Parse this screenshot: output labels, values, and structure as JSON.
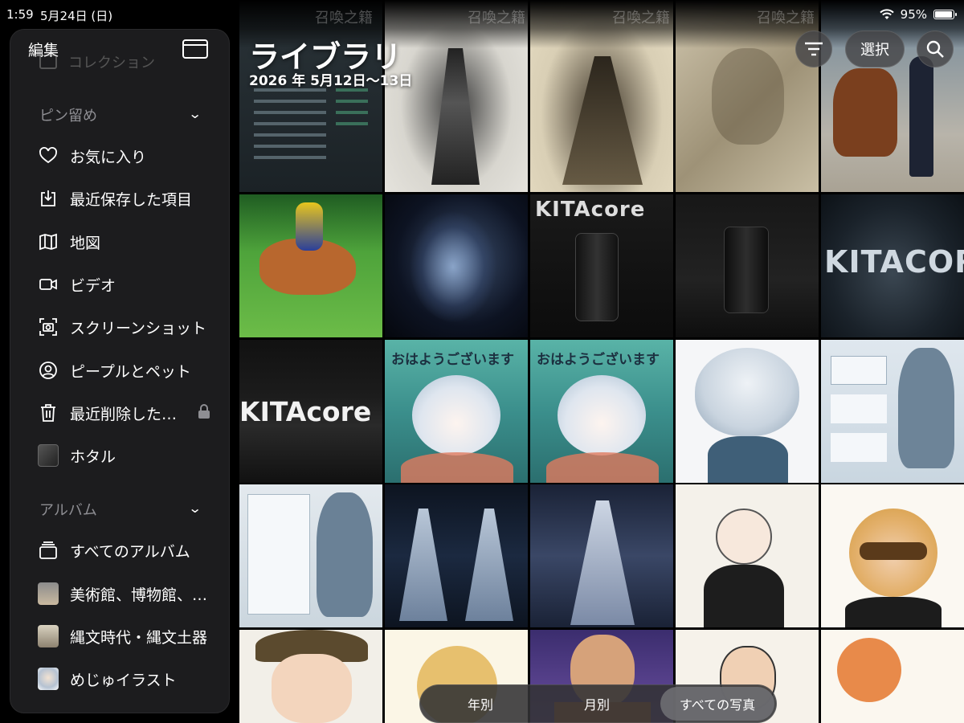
{
  "status": {
    "time": "1:59",
    "date": "5月24日 (日)",
    "battery": "95%",
    "battery_level": 0.95
  },
  "sidebar": {
    "edit_label": "編集",
    "faded_item": "コレクション",
    "pinned_title": "ピン留め",
    "albums_title": "アルバム",
    "items": [
      {
        "label": "お気に入り",
        "icon": "heart-icon"
      },
      {
        "label": "最近保存した項目",
        "icon": "download-icon"
      },
      {
        "label": "地図",
        "icon": "map-icon"
      },
      {
        "label": "ビデオ",
        "icon": "video-icon"
      },
      {
        "label": "スクリーンショット",
        "icon": "screenshot-icon"
      },
      {
        "label": "ピープルとペット",
        "icon": "person-icon"
      },
      {
        "label": "最近削除した…",
        "icon": "trash-icon"
      },
      {
        "label": "ホタル",
        "icon": "album-thumb"
      }
    ],
    "album_items": [
      {
        "label": "すべてのアルバム",
        "icon": "albums-stack-icon"
      },
      {
        "label": "美術館、博物館、…",
        "icon": "album-thumb"
      },
      {
        "label": "縄文時代・縄文土器",
        "icon": "album-thumb"
      },
      {
        "label": "めじゅイラスト",
        "icon": "album-thumb"
      }
    ]
  },
  "header": {
    "title": "ライブラリ",
    "date_range": "2026 年 5月12日〜13日",
    "select_label": "選択",
    "ghost_label": "召喚之籍"
  },
  "grid_texts": {
    "kitacore1": "KITAcore",
    "kitacore2": "KITACORE",
    "kitacore3": "KITAcore",
    "ohayo1": "おはようございます",
    "ohayo2": "おはようございます"
  },
  "bottom_tabs": {
    "year": "年別",
    "month": "月別",
    "all": "すべての写真"
  },
  "colors": {
    "sidebar_bg": "#1c1c1e",
    "secondary_text": "#8e8e93"
  }
}
